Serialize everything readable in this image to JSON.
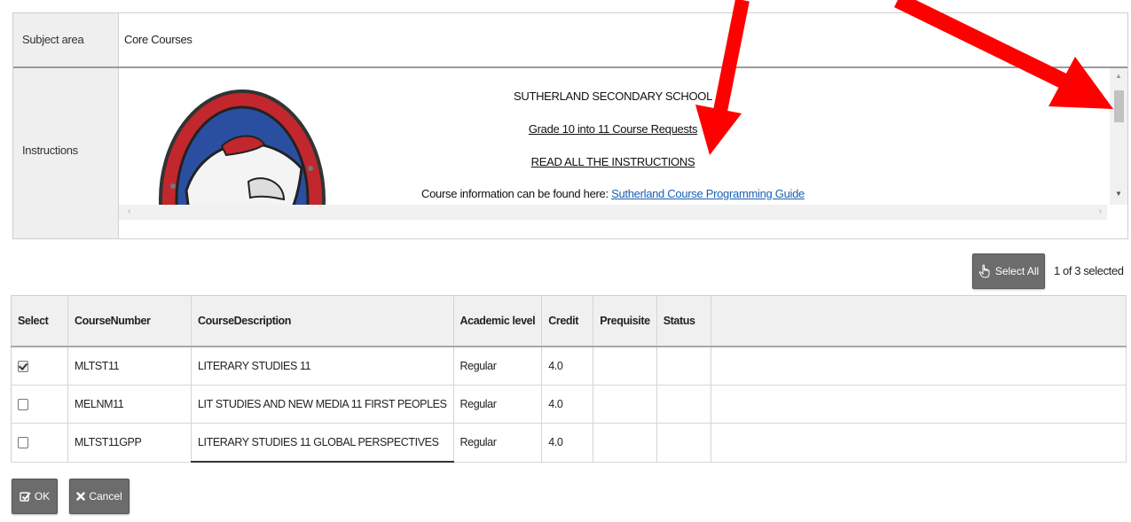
{
  "subject": {
    "label": "Subject area",
    "value": "Core Courses"
  },
  "instructions": {
    "label": "Instructions",
    "school": "SUTHERLAND SECONDARY SCHOOL",
    "grade_line": "Grade 10 into 11 Course Requests",
    "read_all": "READ ALL THE INSTRUCTIONS",
    "info_prefix": "Course information can be found here: ",
    "info_link": "Sutherland Course Programming Guide"
  },
  "selection": {
    "select_all_label": "Select All",
    "count_text": "1 of 3 selected"
  },
  "table": {
    "headers": [
      "Select",
      "CourseNumber",
      "CourseDescription",
      "Academic level",
      "Credit",
      "Prequisite",
      "Status"
    ],
    "rows": [
      {
        "checked": true,
        "number": "MLTST11",
        "description": "LITERARY STUDIES 11",
        "level": "Regular",
        "credit": "4.0",
        "prereq": "",
        "status": ""
      },
      {
        "checked": false,
        "number": "MELNM11",
        "description": "LIT STUDIES AND NEW MEDIA 11 FIRST PEOPLES",
        "level": "Regular",
        "credit": "4.0",
        "prereq": "",
        "status": ""
      },
      {
        "checked": false,
        "number": "MLTST11GPP",
        "description": "LITERARY STUDIES 11 GLOBAL PERSPECTIVES",
        "level": "Regular",
        "credit": "4.0",
        "prereq": "",
        "status": ""
      }
    ]
  },
  "buttons": {
    "ok": "OK",
    "cancel": "Cancel"
  },
  "colors": {
    "button_bg": "#6c6c6c",
    "link": "#1a5fb4",
    "annotation": "#ff0000",
    "logo_red": "#c1272d",
    "logo_blue": "#2b4fa0"
  },
  "icons": [
    "hand-pointer-icon",
    "check-square-icon",
    "x-icon",
    "school-crest-logo"
  ]
}
